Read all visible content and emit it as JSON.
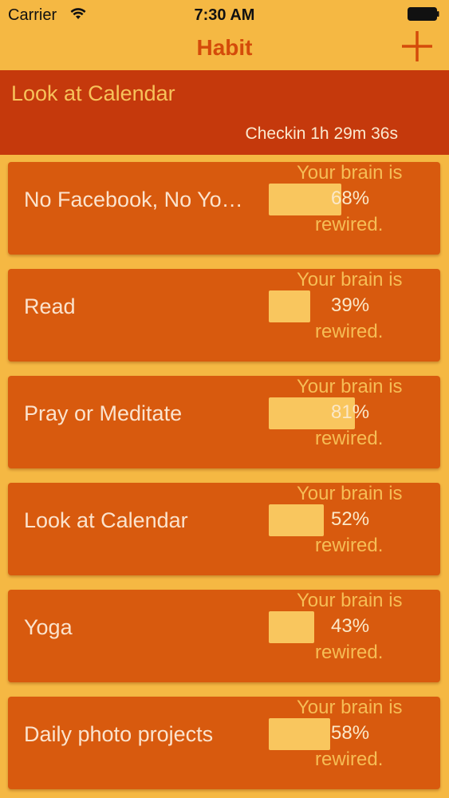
{
  "status_bar": {
    "carrier": "Carrier",
    "time": "7:30 AM"
  },
  "nav": {
    "title": "Habit",
    "add_icon": "plus-icon"
  },
  "current_habit": {
    "title": "Look at Calendar",
    "checkin": "Checkin 1h 29m 36s"
  },
  "habits": [
    {
      "name": "No Facebook, No Yo…",
      "brain_top": "Your brain is",
      "percent_label": "68%",
      "progress": 0.68,
      "brain_bottom": "rewired."
    },
    {
      "name": "Read",
      "brain_top": "Your brain is",
      "percent_label": "39%",
      "progress": 0.39,
      "brain_bottom": "rewired."
    },
    {
      "name": "Pray or Meditate",
      "brain_top": "Your brain is",
      "percent_label": "81%",
      "progress": 0.81,
      "brain_bottom": "rewired."
    },
    {
      "name": "Look at Calendar",
      "brain_top": "Your brain is",
      "percent_label": "52%",
      "progress": 0.52,
      "brain_bottom": "rewired."
    },
    {
      "name": "Yoga",
      "brain_top": "Your brain is",
      "percent_label": "43%",
      "progress": 0.43,
      "brain_bottom": "rewired."
    },
    {
      "name": "Daily photo projects",
      "brain_top": "Your brain is",
      "percent_label": "58%",
      "progress": 0.58,
      "brain_bottom": "rewired."
    }
  ],
  "colors": {
    "background": "#f5b843",
    "accent": "#d44b0a",
    "current_bg": "#c5390c",
    "card_bg": "#d85a0e",
    "bar_fill": "#f9c65e"
  }
}
